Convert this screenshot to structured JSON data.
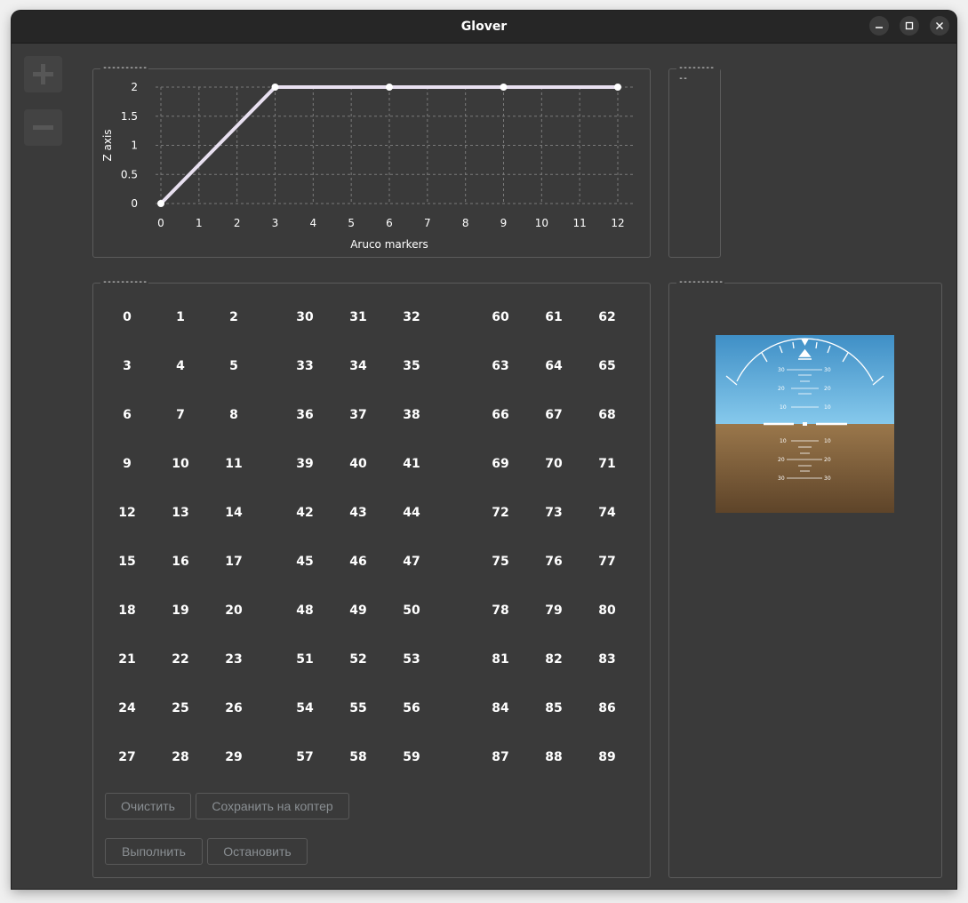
{
  "window": {
    "title": "Glover",
    "controls": {
      "minimize": "−",
      "maximize": "□",
      "close": "×"
    }
  },
  "sidebar": {
    "add_icon": "plus-icon",
    "remove_icon": "minus-icon"
  },
  "groups": {
    "chart_title": "----------",
    "top_right_title": "----------",
    "markers_title": "----------",
    "horizon_title": "----------"
  },
  "chart_data": {
    "type": "line",
    "x": [
      0,
      3,
      6,
      9,
      12
    ],
    "y": [
      0,
      2,
      2,
      2,
      2
    ],
    "xlabel": "Aruco markers",
    "ylabel": "Z axis",
    "xlim": [
      0,
      12
    ],
    "ylim": [
      0,
      2
    ],
    "x_ticks": [
      "0",
      "1",
      "2",
      "3",
      "4",
      "5",
      "6",
      "7",
      "8",
      "9",
      "10",
      "11",
      "12"
    ],
    "y_ticks": [
      "0",
      "0.5",
      "1",
      "1.5",
      "2"
    ],
    "grid": true,
    "line_color": "#e8e0f0"
  },
  "markers": {
    "rows": [
      [
        "0",
        "1",
        "2",
        "30",
        "31",
        "32",
        "60",
        "61",
        "62"
      ],
      [
        "3",
        "4",
        "5",
        "33",
        "34",
        "35",
        "63",
        "64",
        "65"
      ],
      [
        "6",
        "7",
        "8",
        "36",
        "37",
        "38",
        "66",
        "67",
        "68"
      ],
      [
        "9",
        "10",
        "11",
        "39",
        "40",
        "41",
        "69",
        "70",
        "71"
      ],
      [
        "12",
        "13",
        "14",
        "42",
        "43",
        "44",
        "72",
        "73",
        "74"
      ],
      [
        "15",
        "16",
        "17",
        "45",
        "46",
        "47",
        "75",
        "76",
        "77"
      ],
      [
        "18",
        "19",
        "20",
        "48",
        "49",
        "50",
        "78",
        "79",
        "80"
      ],
      [
        "21",
        "22",
        "23",
        "51",
        "52",
        "53",
        "81",
        "82",
        "83"
      ],
      [
        "24",
        "25",
        "26",
        "54",
        "55",
        "56",
        "84",
        "85",
        "86"
      ],
      [
        "27",
        "28",
        "29",
        "57",
        "58",
        "59",
        "87",
        "88",
        "89"
      ]
    ]
  },
  "buttons": {
    "clear": "Очистить",
    "save": "Сохранить на коптер",
    "run": "Выполнить",
    "stop": "Остановить"
  },
  "horizon": {
    "sky_labels": [
      "30",
      "20",
      "10"
    ],
    "ground_labels": [
      "10",
      "20",
      "30"
    ],
    "sky_color": "#5aa8dc",
    "ground_color": "#8a6a45"
  }
}
